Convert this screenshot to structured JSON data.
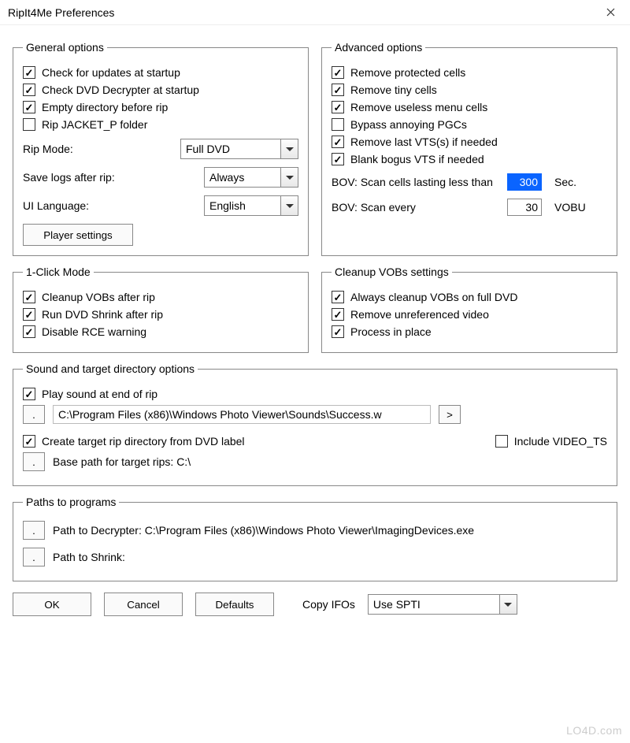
{
  "window": {
    "title": "RipIt4Me Preferences"
  },
  "general": {
    "legend": "General options",
    "check_updates": "Check for updates at startup",
    "check_decrypter": "Check DVD Decrypter at startup",
    "empty_dir": "Empty directory before rip",
    "rip_jacket": "Rip JACKET_P folder",
    "rip_mode_label": "Rip Mode:",
    "rip_mode_value": "Full DVD",
    "save_logs_label": "Save logs after rip:",
    "save_logs_value": "Always",
    "ui_lang_label": "UI Language:",
    "ui_lang_value": "English",
    "player_settings": "Player settings"
  },
  "advanced": {
    "legend": "Advanced options",
    "remove_protected": "Remove protected cells",
    "remove_tiny": "Remove tiny cells",
    "remove_useless": "Remove useless menu cells",
    "bypass": "Bypass annoying PGCs",
    "remove_last_vts": "Remove last VTS(s) if needed",
    "blank_bogus": "Blank bogus VTS if needed",
    "bov_scan_label": "BOV: Scan cells lasting less than",
    "bov_scan_value": "300",
    "bov_scan_unit": "Sec.",
    "bov_every_label": "BOV: Scan every",
    "bov_every_value": "30",
    "bov_every_unit": "VOBU"
  },
  "oneclick": {
    "legend": "1-Click Mode",
    "cleanup_vobs": "Cleanup VOBs after rip",
    "run_shrink": "Run DVD Shrink after rip",
    "disable_rce": "Disable RCE warning"
  },
  "cleanup": {
    "legend": "Cleanup VOBs settings",
    "always_cleanup": "Always cleanup VOBs on full DVD",
    "remove_unref": "Remove unreferenced video",
    "process_in_place": "Process in place"
  },
  "sound": {
    "legend": "Sound and target directory options",
    "play_sound": "Play sound at end of rip",
    "sound_path": "C:\\Program Files (x86)\\Windows Photo Viewer\\Sounds\\Success.w",
    "browse_gt": ">",
    "create_target": "Create target rip directory from DVD label",
    "include_video_ts": "Include VIDEO_TS",
    "base_path": "Base path for target rips: C:\\",
    "dot": "."
  },
  "paths": {
    "legend": "Paths to programs",
    "decrypter": "Path to Decrypter: C:\\Program Files (x86)\\Windows Photo Viewer\\ImagingDevices.exe",
    "shrink": "Path to Shrink:",
    "dot": "."
  },
  "buttons": {
    "ok": "OK",
    "cancel": "Cancel",
    "defaults": "Defaults",
    "copy_ifos_label": "Copy IFOs",
    "copy_ifos_value": "Use SPTI"
  },
  "watermark": "LO4D.com"
}
